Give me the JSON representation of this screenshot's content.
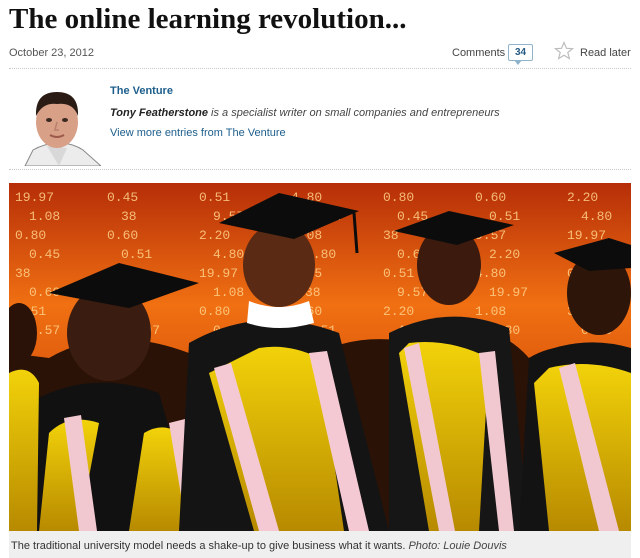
{
  "article": {
    "headline": "The online learning revolution...",
    "date": "October 23, 2012",
    "comments_label": "Comments",
    "comments_count": "34",
    "read_later_label": "Read later"
  },
  "author": {
    "blog_name": "The Venture",
    "name": "Tony Featherstone",
    "bio": " is a specialist writer on small companies and entrepreneurs",
    "more_link": "View more entries from The Venture"
  },
  "photo": {
    "caption": "The traditional university model needs a shake-up to give business what it wants. ",
    "credit": "Photo: Louie Douvis",
    "board_text": [
      "19.97",
      "0.45",
      "0.51",
      "4.80",
      "0.80",
      "0.60",
      "2.20",
      "1.08",
      "38",
      "9.57"
    ]
  },
  "colors": {
    "link": "#1d5e8c",
    "gown_gold": "#e9c000",
    "board_orange": "#e8620e"
  }
}
